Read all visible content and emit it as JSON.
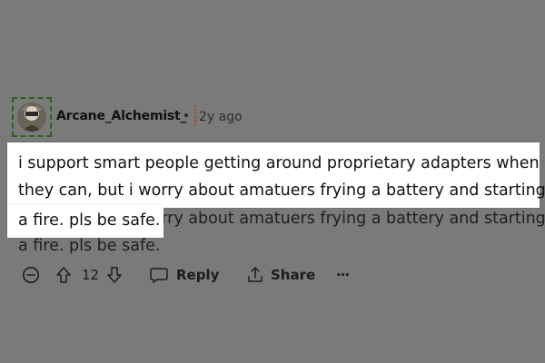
{
  "comment": {
    "author": "Arcane_Alchemist_",
    "timestamp": "2y ago",
    "background_body": {
      "line1": "they can, but i worry about amatuers frying a battery and starting",
      "line2": "a fire. pls be safe."
    },
    "highlighted_body": {
      "line1": "i support smart people getting around proprietary adapters when",
      "line2": "they can, but i worry about amatuers frying a battery and starting",
      "line3": "a fire. pls be safe."
    },
    "vote_count": "12",
    "reply_label": "Reply",
    "share_label": "Share",
    "more_label": "···"
  },
  "icons": {
    "collapse": "minus-circle-icon",
    "upvote": "arrow-up-icon",
    "downvote": "arrow-down-icon",
    "reply": "speech-bubble-icon",
    "share": "share-upload-icon",
    "more": "ellipsis-icon"
  },
  "colors": {
    "background": "#7a7a7a",
    "highlight": "#ffffff",
    "avatar_border": "#2f5f1e",
    "cursor_line": "#c0392b"
  }
}
